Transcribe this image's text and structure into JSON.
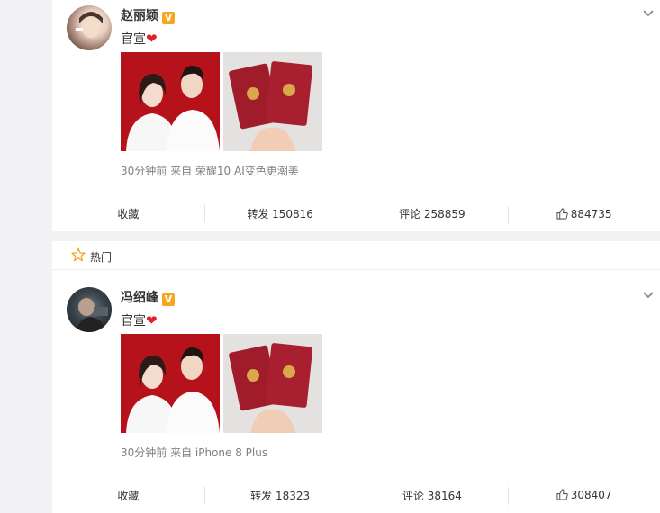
{
  "posts": [
    {
      "username": "赵丽颖",
      "verified_badge": "V",
      "text": "官宣",
      "emoji": "❤",
      "meta": "30分钟前 来自 荣耀10 AI变色更潮美",
      "actions": {
        "favorite": "收藏",
        "repost": "转发 150816",
        "comment": "评论 258859",
        "like": "884735"
      }
    },
    {
      "username": "冯绍峰",
      "verified_badge": "V",
      "text": "官宣",
      "emoji": "❤",
      "meta": "30分钟前 来自 iPhone 8 Plus",
      "actions": {
        "favorite": "收藏",
        "repost": "转发 18323",
        "comment": "评论 38164",
        "like": "308407"
      }
    }
  ],
  "hot": {
    "label": "热门",
    "icon": "star-outline-icon"
  },
  "icons": {
    "more": "chevron-down-icon",
    "like": "thumbs-up-icon"
  },
  "colors": {
    "accent_heart": "#e0202c",
    "badge": "#f6a623",
    "cert_red": "#a01c2a",
    "backdrop_red": "#b5121b"
  }
}
